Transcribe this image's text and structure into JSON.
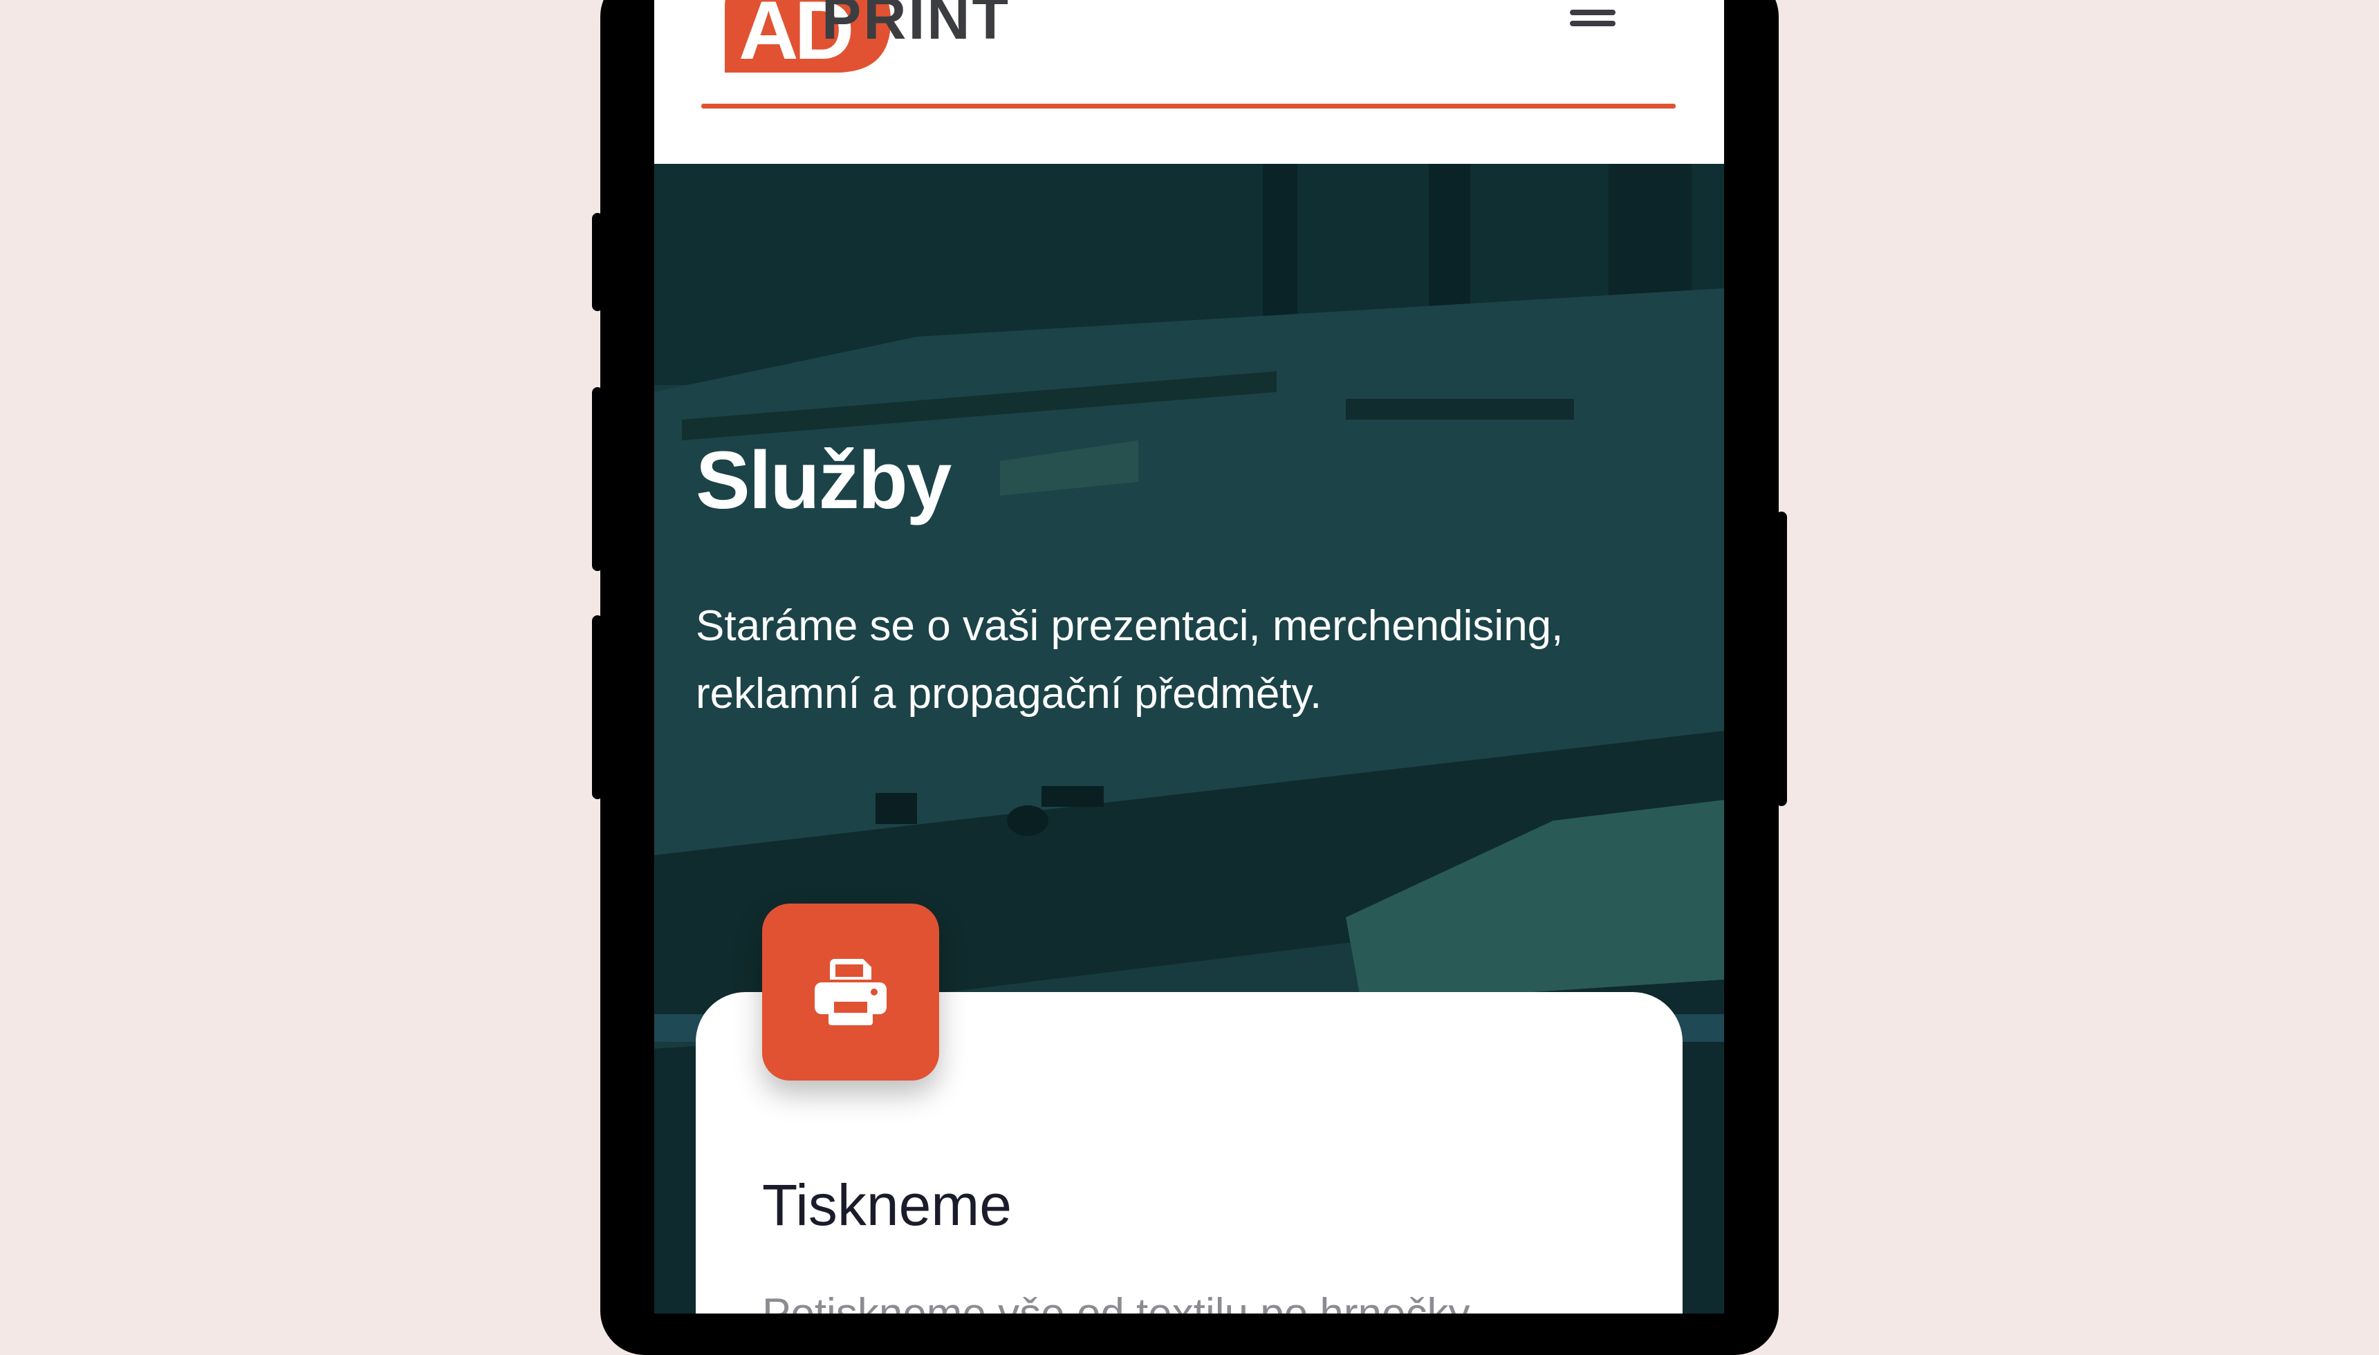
{
  "header": {
    "logo_mark": "AD",
    "logo_text": "PRINT",
    "menu_icon": "hamburger-menu-icon"
  },
  "hero": {
    "title": "Služby",
    "description": "Staráme se o vaši prezentaci, merchendising, reklamní a propagační předměty."
  },
  "service_card": {
    "icon": "printer-icon",
    "title": "Tiskneme",
    "text": "Potiskneme vše od textilu po hrnečky"
  },
  "colors": {
    "accent": "#e05232",
    "hero_overlay": "#12343a",
    "page_background": "#f4e8e7",
    "text_dark": "#1b1c2b"
  }
}
